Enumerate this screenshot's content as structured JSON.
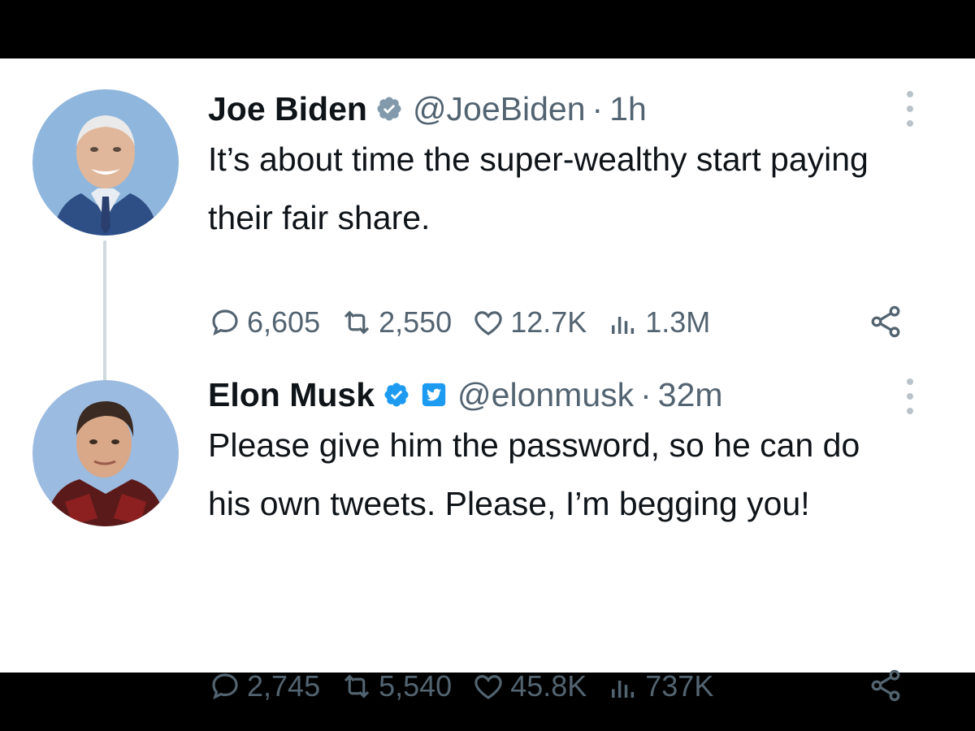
{
  "tweets": [
    {
      "name": "Joe Biden",
      "handle": "@JoeBiden",
      "separator": "·",
      "time": "1h",
      "text": "It’s about time the super-wealthy start paying their fair share.",
      "badges": [
        "verified-gray-icon"
      ],
      "stats": {
        "replies": "6,605",
        "retweets": "2,550",
        "likes": "12.7K",
        "views": "1.3M"
      }
    },
    {
      "name": "Elon Musk",
      "handle": "@elonmusk",
      "separator": "·",
      "time": "32m",
      "text": "Please give him the password, so he can do his own tweets. Please, I’m begging you!",
      "badges": [
        "verified-blue-icon",
        "twitter-affiliate-icon"
      ],
      "stats": {
        "replies": "2,745",
        "retweets": "5,540",
        "likes": "45.8K",
        "views": "737K"
      }
    }
  ],
  "colors": {
    "text": "#0f1419",
    "muted": "#536471",
    "blue": "#1d9bf0",
    "gray_badge": "#829aab",
    "thread_line": "#cfd9de"
  }
}
